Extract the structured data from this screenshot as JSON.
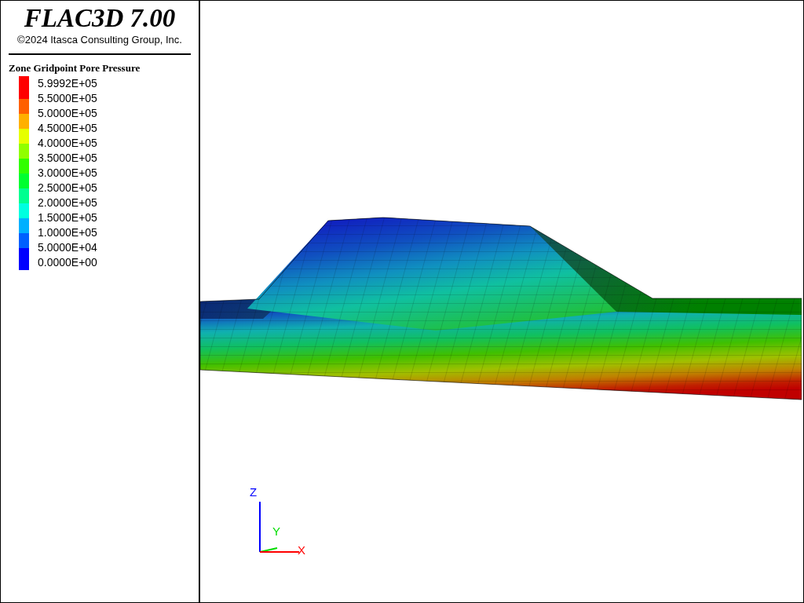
{
  "title": "FLAC3D 7.00",
  "copyright": "©2024 Itasca Consulting Group, Inc.",
  "legend": {
    "title": "Zone Gridpoint Pore Pressure",
    "entries": [
      {
        "label": "5.9992E+05"
      },
      {
        "label": "5.5000E+05"
      },
      {
        "label": "5.0000E+05"
      },
      {
        "label": "4.5000E+05"
      },
      {
        "label": "4.0000E+05"
      },
      {
        "label": "3.5000E+05"
      },
      {
        "label": "3.0000E+05"
      },
      {
        "label": "2.5000E+05"
      },
      {
        "label": "2.0000E+05"
      },
      {
        "label": "1.5000E+05"
      },
      {
        "label": "1.0000E+05"
      },
      {
        "label": "5.0000E+04"
      },
      {
        "label": "0.0000E+00"
      }
    ],
    "bands": [
      {
        "color": "#ff0000"
      },
      {
        "color": "#ff6000"
      },
      {
        "color": "#ffb000"
      },
      {
        "color": "#e6ff00"
      },
      {
        "color": "#90ff00"
      },
      {
        "color": "#30ff00"
      },
      {
        "color": "#00ff30"
      },
      {
        "color": "#00ff90"
      },
      {
        "color": "#00ffe0"
      },
      {
        "color": "#00b0ff"
      },
      {
        "color": "#0060ff"
      },
      {
        "color": "#0000ff"
      }
    ]
  },
  "axes": [
    {
      "label": "Z",
      "color": "#0000ff"
    },
    {
      "label": "Y",
      "color": "#00dd00"
    },
    {
      "label": "X",
      "color": "#ff0000"
    }
  ]
}
